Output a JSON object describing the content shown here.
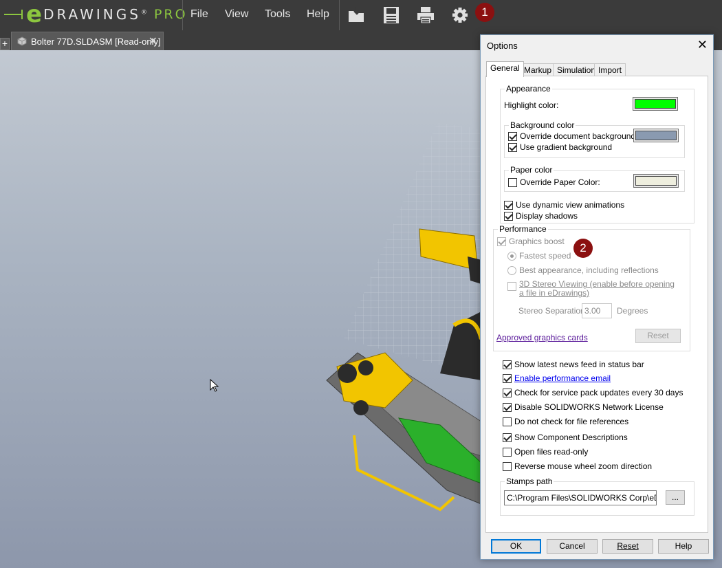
{
  "app": {
    "logo_e": "e",
    "logo_text": "DRAWINGS",
    "logo_reg": "®",
    "logo_pro": "PRO",
    "menu": [
      "File",
      "View",
      "Tools",
      "Help"
    ],
    "toolbar_icons": [
      "open-folder-icon",
      "save-icon",
      "print-icon",
      "gear-icon"
    ],
    "badge_1": "1",
    "badge_2": "2"
  },
  "tabs": {
    "new_tab_label": "+",
    "document_title": "Bolter 77D.SLDASM [Read-only]",
    "close_glyph": "✕"
  },
  "dialog": {
    "title": "Options",
    "close_glyph": "✕",
    "tabs": [
      "General",
      "Markup",
      "Simulation",
      "Import"
    ],
    "appearance": {
      "legend": "Appearance",
      "highlight_label": "Highlight color:",
      "highlight_color": "#00ff00",
      "background_color": {
        "legend": "Background color",
        "override_label": "Override document background:",
        "override_checked": true,
        "override_color": "#8a9ab0",
        "gradient_label": "Use gradient background",
        "gradient_checked": true
      },
      "paper_color": {
        "legend": "Paper color",
        "override_label": "Override Paper Color:",
        "override_checked": false,
        "paper_color": "#eeeede"
      },
      "dynamic_view_label": "Use dynamic view animations",
      "dynamic_view_checked": true,
      "shadows_label": "Display shadows",
      "shadows_checked": true
    },
    "performance": {
      "legend": "Performance",
      "graphics_boost_label": "Graphics boost",
      "fastest_label": "Fastest speed",
      "best_label": "Best appearance, including reflections",
      "stereo_label": "3D Stereo Viewing (enable before opening a file in eDrawings)",
      "stereo_sep_label": "Stereo Separation:",
      "stereo_sep_value": "3.00",
      "stereo_sep_unit": "Degrees",
      "approved_link": "Approved graphics cards",
      "reset_label": "Reset"
    },
    "options": [
      {
        "label": "Show latest news feed in status bar",
        "checked": true
      },
      {
        "label": "Enable performance email",
        "checked": true
      },
      {
        "label": "Check for service pack updates every 30 days",
        "checked": true
      },
      {
        "label": "Disable SOLIDWORKS Network License",
        "checked": true
      },
      {
        "label": "Do not check for file references",
        "checked": false
      },
      {
        "label": "Show Component Descriptions",
        "checked": true
      },
      {
        "label": "Open files read-only",
        "checked": false
      },
      {
        "label": "Reverse mouse wheel zoom direction",
        "checked": false
      }
    ],
    "stamps": {
      "legend": "Stamps path",
      "path_value": "C:\\Program Files\\SOLIDWORKS Corp\\eDraw",
      "browse_label": "..."
    },
    "buttons": {
      "ok": "OK",
      "cancel": "Cancel",
      "reset": "Reset",
      "help": "Help"
    }
  }
}
